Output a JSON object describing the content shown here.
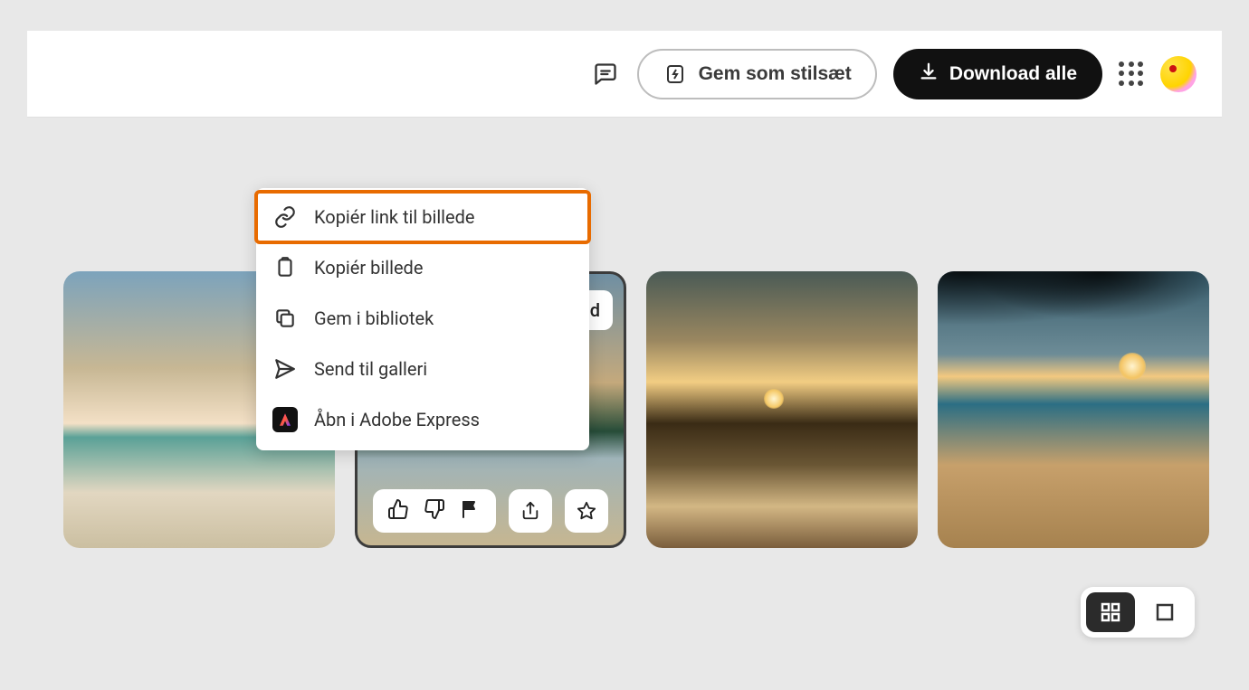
{
  "header": {
    "save_style_label": "Gem som stilsæt",
    "download_all_label": "Download alle"
  },
  "context_menu": {
    "items": [
      {
        "label": "Kopiér link til billede",
        "highlighted": true
      },
      {
        "label": "Kopiér billede"
      },
      {
        "label": "Gem i bibliotek"
      },
      {
        "label": "Send til galleri"
      },
      {
        "label": "Åbn i Adobe Express"
      }
    ]
  },
  "thumb_overlay": {
    "download_partial_label": "load"
  }
}
